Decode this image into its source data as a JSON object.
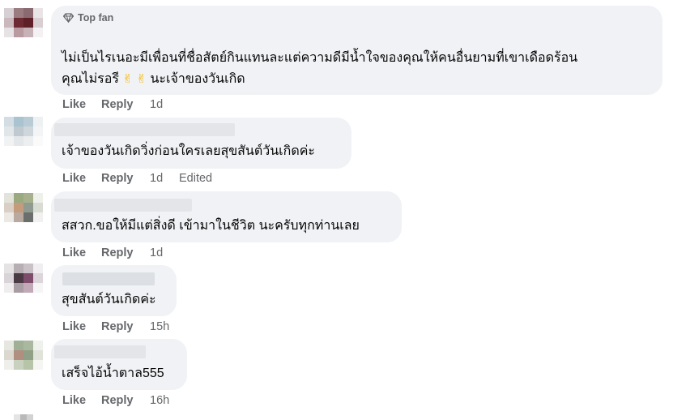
{
  "comments": [
    {
      "badge": "Top fan",
      "text_line1": "ไม่เป็นไรเนอะมีเพื่อนที่ชื่อสัตย์กินแทนละแต่ความดีมีน้ำใจของคุณให้คนอื่นยามที่เขาเดือดร้อน",
      "text_line2_a": "คุณไม่รอรี",
      "emoji": "✌",
      "text_line2_b": "นะเจ้าของวันเกิด",
      "like": "Like",
      "reply": "Reply",
      "time": "1d"
    },
    {
      "text": "เจ้าของวันเกิดวิ่งก่อนใครเลยสุขสันต์วันเกิดค่ะ",
      "like": "Like",
      "reply": "Reply",
      "time": "1d",
      "edited": "Edited"
    },
    {
      "text": "สสวก.ขอให้มีแต่สิ่งดี เข้ามาในชีวิต นะครับทุกท่านเลย",
      "like": "Like",
      "reply": "Reply",
      "time": "1d"
    },
    {
      "text": "สุขสันต์วันเกิดค่ะ",
      "like": "Like",
      "reply": "Reply",
      "time": "15h"
    },
    {
      "text": "เสร็จไอ้น้ำตาล555",
      "like": "Like",
      "reply": "Reply",
      "time": "16h"
    }
  ]
}
